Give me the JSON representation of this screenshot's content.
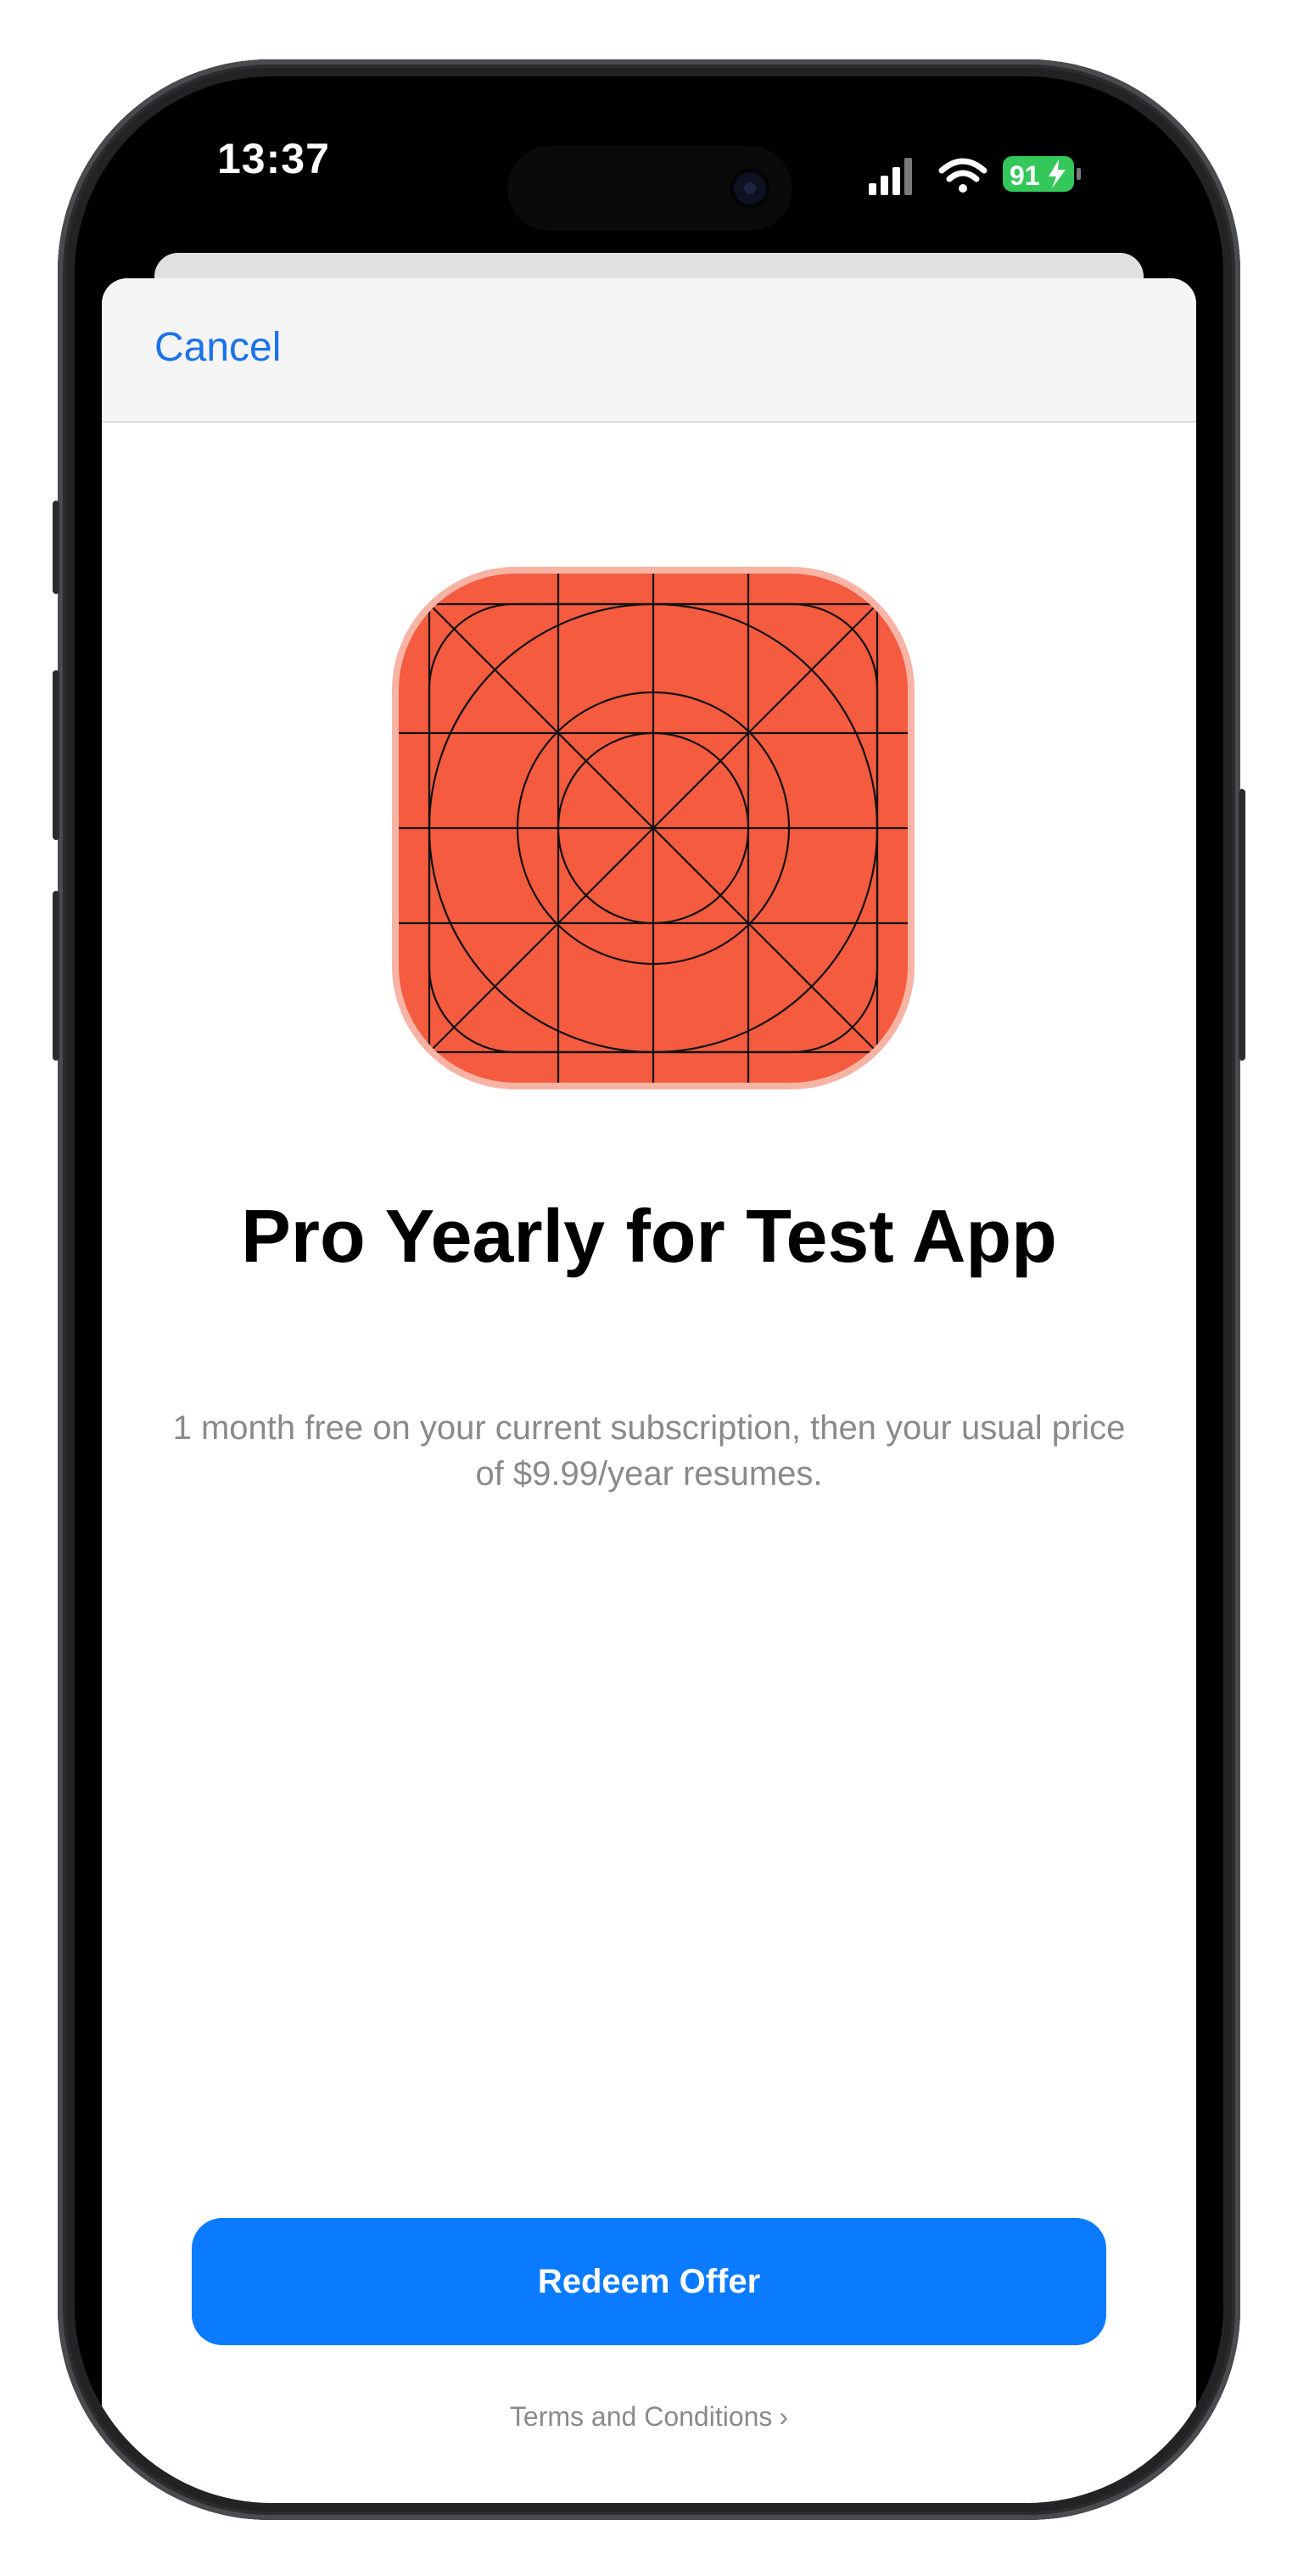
{
  "status_bar": {
    "time": "13:37",
    "battery_percent": "91",
    "icons": [
      "signal-icon",
      "wifi-icon",
      "battery-charging-icon"
    ]
  },
  "nav": {
    "cancel_label": "Cancel"
  },
  "offer": {
    "app_icon": "app-icon-grid-template",
    "title": "Pro Yearly for Test App",
    "description": "1 month free on your current subscription, then your usual price of $9.99/year resumes."
  },
  "actions": {
    "redeem_label": "Redeem Offer",
    "terms_label": "Terms and Conditions",
    "terms_chevron": "›"
  },
  "colors": {
    "accent": "#0a7bff",
    "app_icon_fill": "#f45b3f",
    "battery": "#34c759"
  }
}
